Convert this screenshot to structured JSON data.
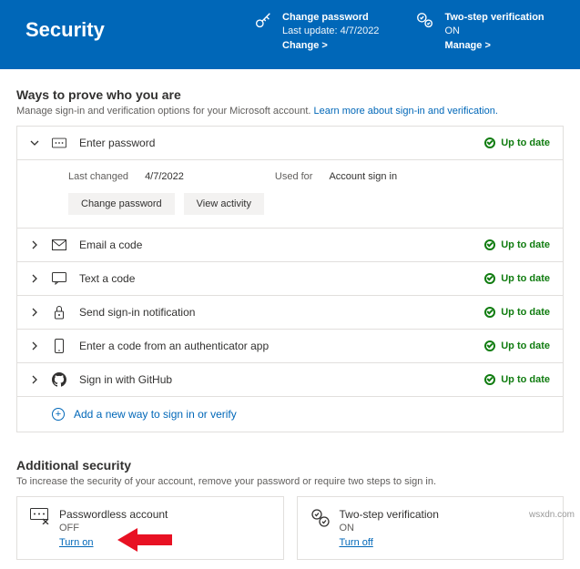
{
  "header": {
    "title": "Security",
    "tile1": {
      "label": "Change password",
      "sub": "Last update: 4/7/2022",
      "link": "Change >"
    },
    "tile2": {
      "label": "Two-step verification",
      "sub": "ON",
      "link": "Manage >"
    }
  },
  "ways": {
    "heading": "Ways to prove who you are",
    "sub_pre": "Manage sign-in and verification options for your Microsoft account. ",
    "sub_link": "Learn more about sign-in and verification."
  },
  "rows": [
    {
      "label": "Enter password",
      "status": "Up to date",
      "expanded": true
    },
    {
      "label": "Email a code",
      "status": "Up to date"
    },
    {
      "label": "Text a code",
      "status": "Up to date"
    },
    {
      "label": "Send sign-in notification",
      "status": "Up to date"
    },
    {
      "label": "Enter a code from an authenticator app",
      "status": "Up to date"
    },
    {
      "label": "Sign in with GitHub",
      "status": "Up to date"
    }
  ],
  "panel": {
    "last_changed_label": "Last changed",
    "last_changed_value": "4/7/2022",
    "used_for_label": "Used for",
    "used_for_value": "Account sign in",
    "btn_change": "Change password",
    "btn_activity": "View activity"
  },
  "add_new": "Add a new way to sign in or verify",
  "additional": {
    "heading": "Additional security",
    "sub": "To increase the security of your account, remove your password or require two steps to sign in.",
    "card1": {
      "title": "Passwordless account",
      "state": "OFF",
      "link": "Turn on"
    },
    "card2": {
      "title": "Two-step verification",
      "state": "ON",
      "link": "Turn off"
    }
  },
  "watermark": "wsxdn.com"
}
